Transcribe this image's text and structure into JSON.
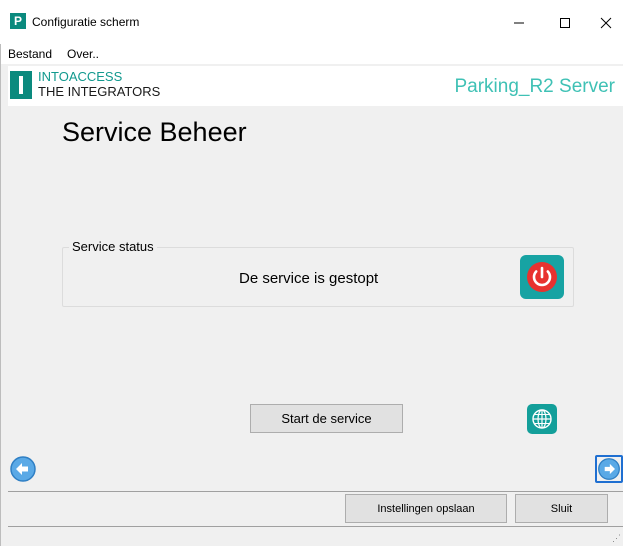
{
  "window": {
    "icon_letter": "P",
    "title": "Configuratie scherm",
    "min_label": "—",
    "close_label": "✕"
  },
  "menu": {
    "items": [
      "Bestand",
      "Over.."
    ]
  },
  "brand": {
    "logo_line1": "INTOACCESS",
    "logo_line2": "THE INTEGRATORS",
    "product": "Parking_R2 Server",
    "accent_color": "#0b8a7e",
    "product_color": "#3fc1b5"
  },
  "main": {
    "title": "Service Beheer",
    "status_legend": "Service status",
    "status_text": "De service is gestopt",
    "start_label": "Start de service"
  },
  "footer": {
    "save_label": "Instellingen opslaan",
    "close_label": "Sluit"
  },
  "icons": {
    "power": "power-icon",
    "globe": "globe-icon",
    "back": "arrow-left-icon",
    "next": "arrow-right-icon"
  }
}
